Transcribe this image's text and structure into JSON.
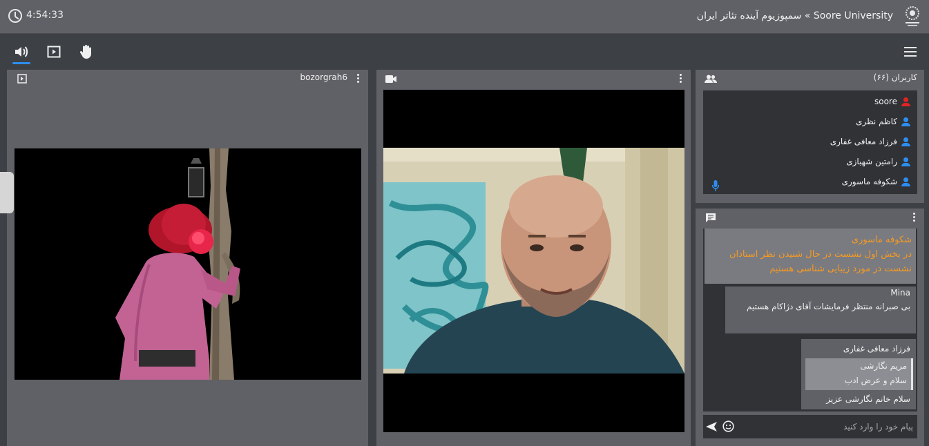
{
  "header": {
    "clock": "4:54:33",
    "title": "Soore University » سمپوزیوم آینده تئاتر ایران",
    "logo_icon": "university-seal-icon"
  },
  "toolbar": {
    "icons": [
      "volume-icon",
      "screen-share-icon",
      "raise-hand-icon",
      "menu-icon"
    ],
    "accent": "#2d8ef0"
  },
  "presentation": {
    "name": "bozorgrah6",
    "icon": "presentation-icon"
  },
  "webcam": {
    "icon": "video-camera-icon"
  },
  "users": {
    "title": "کاربران (۶۶)",
    "items": [
      {
        "name": "soore",
        "color": "#e02424"
      },
      {
        "name": "کاظم نظری",
        "color": "#2d8ef0"
      },
      {
        "name": "فرزاد معافی غفاری",
        "color": "#2d8ef0"
      },
      {
        "name": "رامتین شهبازی",
        "color": "#2d8ef0"
      },
      {
        "name": "شکوفه ماسوری",
        "color": "#2d8ef0"
      }
    ]
  },
  "chat": {
    "pinned": {
      "author": "شکوفه ماسوری",
      "line1": "در بخش اول نشست در حال شنیدن نظر استادان",
      "line2": "نشست در مورد زیبایی شناسی هستیم",
      "color": "#f59a23"
    },
    "message1": {
      "author": "Mina",
      "text": "بی صبرانه منتظر فرمایشات آقای دژاکام هستیم"
    },
    "message2": {
      "author": "فرزاد معافی غفاری",
      "quote_author": "مریم نگارشی",
      "quote_text": "سلام و عرض ادب",
      "text": "سلام خانم نگارشی عزیز"
    },
    "input_placeholder": "پیام خود را وارد کنید"
  }
}
